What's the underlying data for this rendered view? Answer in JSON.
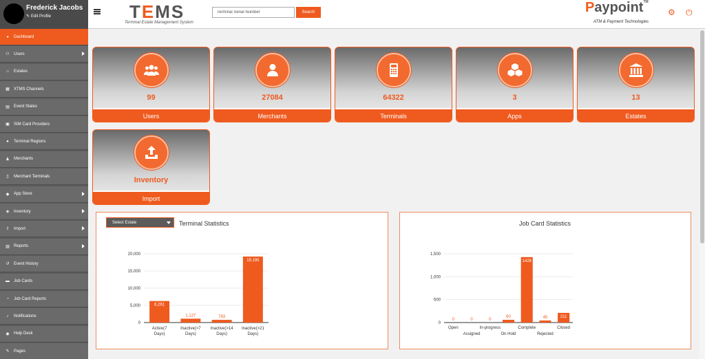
{
  "profile": {
    "name": "Frederick Jacobs",
    "edit_label": "Edit Profile"
  },
  "sidebar": {
    "items": [
      {
        "label": "Dashboard",
        "icon": "palette-icon",
        "active": true,
        "has_submenu": false
      },
      {
        "label": "Users",
        "icon": "users-icon",
        "active": false,
        "has_submenu": true
      },
      {
        "label": "Estates",
        "icon": "bank-icon",
        "active": false,
        "has_submenu": false
      },
      {
        "label": "XTMS Channels",
        "icon": "grid-icon",
        "active": false,
        "has_submenu": false
      },
      {
        "label": "Event States",
        "icon": "calendar-icon",
        "active": false,
        "has_submenu": false
      },
      {
        "label": "SIM Card Providers",
        "icon": "sim-card-icon",
        "active": false,
        "has_submenu": false
      },
      {
        "label": "Terminal Regions",
        "icon": "globe-icon",
        "active": false,
        "has_submenu": false
      },
      {
        "label": "Merchants",
        "icon": "user-icon",
        "active": false,
        "has_submenu": false
      },
      {
        "label": "Merchant Terminals",
        "icon": "terminal-icon",
        "active": false,
        "has_submenu": false
      },
      {
        "label": "App Store",
        "icon": "store-icon",
        "active": false,
        "has_submenu": true
      },
      {
        "label": "Inventory",
        "icon": "box-icon",
        "active": false,
        "has_submenu": true
      },
      {
        "label": "Import",
        "icon": "upload-icon",
        "active": false,
        "has_submenu": true
      },
      {
        "label": "Reports",
        "icon": "report-icon",
        "active": false,
        "has_submenu": true
      },
      {
        "label": "Event History",
        "icon": "history-icon",
        "active": false,
        "has_submenu": false
      },
      {
        "label": "Job Cards",
        "icon": "card-icon",
        "active": false,
        "has_submenu": false
      },
      {
        "label": "Job Card Reports",
        "icon": "chart-icon",
        "active": false,
        "has_submenu": false
      },
      {
        "label": "Notifications",
        "icon": "bell-icon",
        "active": false,
        "has_submenu": false
      },
      {
        "label": "Help Desk",
        "icon": "help-icon",
        "active": false,
        "has_submenu": false
      },
      {
        "label": "Pages",
        "icon": "pencil-icon",
        "active": false,
        "has_submenu": false
      }
    ]
  },
  "header": {
    "logo_tems": "TEMS",
    "logo_tems_sub": "Terminal Estate Management System",
    "search_placeholder": "Terminal Serial Number",
    "search_button": "Search",
    "logo_paypoint": "Paypoint",
    "logo_paypoint_tm": "TM",
    "logo_paypoint_sub": "ATM & Payment Technologies"
  },
  "cards": [
    {
      "value": "99",
      "label": "Users",
      "icon": "users-icon"
    },
    {
      "value": "27084",
      "label": "Merchants",
      "icon": "user-icon"
    },
    {
      "value": "64322",
      "label": "Terminals",
      "icon": "calculator-icon"
    },
    {
      "value": "3",
      "label": "Apps",
      "icon": "cubes-icon"
    },
    {
      "value": "13",
      "label": "Estates",
      "icon": "bank-icon"
    },
    {
      "value": "Inventory",
      "label": "Import",
      "icon": "upload-icon"
    }
  ],
  "terminal_panel": {
    "select_label": "Select Estate",
    "title": "Terminal Statistics"
  },
  "jobcard_panel": {
    "title": "Job Card Statistics"
  },
  "colors": {
    "accent": "#ef5a1f",
    "sidebar": "#6a6a6a",
    "sidebar_dark": "#4a4a4a"
  },
  "chart_data": [
    {
      "type": "bar",
      "categories": [
        "Active(7 Days)",
        "Inactive(>7 Days)",
        "Inactive(>14 Days)",
        "Inactive(>21 Days)"
      ],
      "category_lines": [
        [
          "Active(7",
          "Days)"
        ],
        [
          "Inactive(>7",
          "Days)"
        ],
        [
          "Inactive(>14",
          "Days)"
        ],
        [
          "Inactive(>21",
          "Days)"
        ]
      ],
      "values": [
        6261,
        1127,
        783,
        19195
      ],
      "value_labels": [
        "6,261",
        "1,127",
        "783",
        "19,195"
      ],
      "ylim": [
        0,
        20000
      ],
      "yticks": [
        0,
        5000,
        10000,
        15000,
        20000
      ],
      "ytick_labels": [
        "0",
        "5,000",
        "10,000",
        "15,000",
        "20,000"
      ],
      "grid": true,
      "color": "#ef5a1f"
    },
    {
      "type": "bar",
      "categories": [
        "Open",
        "Assigned",
        "In-progress",
        "On Hold",
        "Complete",
        "Rejected",
        "Closed"
      ],
      "values": [
        0,
        0,
        0,
        60,
        1428,
        45,
        211
      ],
      "value_labels": [
        "0",
        "0",
        "0",
        "60",
        "1428",
        "45",
        "211"
      ],
      "ylim": [
        0,
        1500
      ],
      "yticks": [
        0,
        500,
        1000,
        1500
      ],
      "ytick_labels": [
        "0",
        "500",
        "1,000",
        "1,500"
      ],
      "grid": true,
      "color": "#ef5a1f"
    }
  ]
}
